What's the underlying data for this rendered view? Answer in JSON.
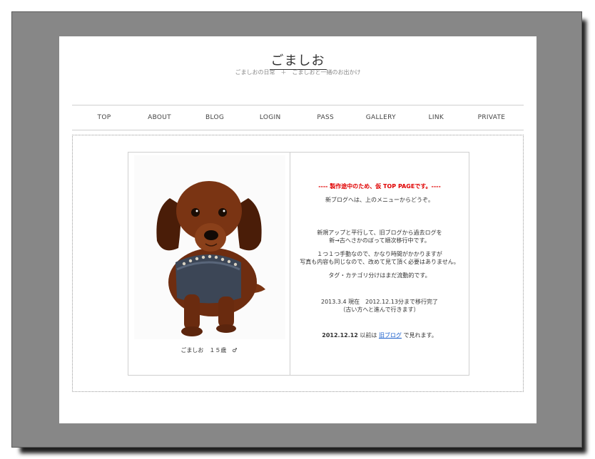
{
  "site": {
    "title": "ごましお",
    "tagline": "ごましおの日常　＋　ごましおと一緒のお出かけ"
  },
  "nav": {
    "items": [
      {
        "label": "TOP"
      },
      {
        "label": "ABOUT"
      },
      {
        "label": "BLOG"
      },
      {
        "label": "LOGIN"
      },
      {
        "label": "PASS"
      },
      {
        "label": "GALLERY"
      },
      {
        "label": "LINK"
      },
      {
        "label": "PRIVATE"
      }
    ]
  },
  "profile": {
    "caption": "ごましお　１５歳　♂"
  },
  "notice": {
    "headline": "---- 製作途中のため、仮 TOP PAGEです。----",
    "line1": "新ブログへは、上のメニューからどうぞ。",
    "line2a": "新規アップと平行して、旧ブログから過去ログを",
    "line2b": "新→古へさかのぼって順次移行中です。",
    "line3a": "１つ１つ手動なので、かなり時間がかかりますが",
    "line3b": "写真も内容も同じなので、改めて見て頂く必要はありません。",
    "line4": "タグ・カテゴリ分けはまだ流動的です。",
    "line5a": "2013.3.4 現在　2012.12.13分まで移行完了",
    "line5b": "（古い方へと進んで行きます）",
    "old_date": "2012.12.12",
    "old_mid": " 以前は ",
    "old_link": "旧ブログ",
    "old_end": " で見れます。"
  }
}
